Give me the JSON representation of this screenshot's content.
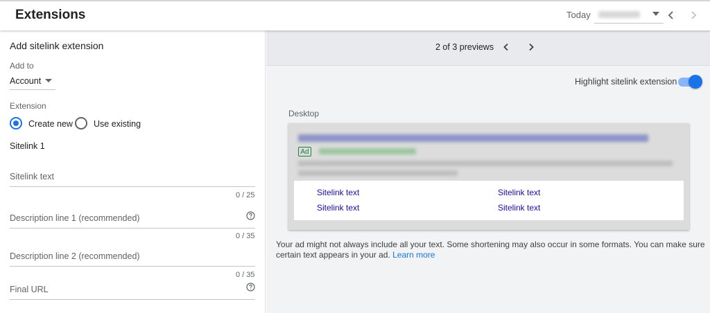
{
  "header": {
    "title": "Extensions",
    "today_label": "Today",
    "date_value": ""
  },
  "form": {
    "section_title": "Add sitelink extension",
    "add_to_label": "Add to",
    "add_to_value": "Account",
    "extension_label": "Extension",
    "radio_create": "Create new",
    "radio_existing": "Use existing",
    "selected": "Create new",
    "sitelink_heading": "Sitelink 1",
    "fields": [
      {
        "label": "Sitelink text",
        "counter": "0 / 25",
        "help": false
      },
      {
        "label": "Description line 1 (recommended)",
        "counter": "0 / 35",
        "help": true
      },
      {
        "label": "Description line 2 (recommended)",
        "counter": "0 / 35",
        "help": false
      },
      {
        "label": "Final URL",
        "counter": "",
        "help": true
      }
    ]
  },
  "preview": {
    "count_text": "2 of 3 previews",
    "highlight_label": "Highlight sitelink extension",
    "highlight_on": true,
    "device_label": "Desktop",
    "ad_badge": "Ad",
    "sitelinks": [
      "Sitelink text",
      "Sitelink text",
      "Sitelink text",
      "Sitelink text"
    ],
    "note_text": "Your ad might not always include all your text. Some shortening may also occur in some formats. You can make sure certain text appears in your ad.",
    "learn_more": "Learn more"
  },
  "icons": {
    "prev": "chevron-left-icon",
    "next": "chevron-right-icon",
    "help": "help-circle-icon",
    "dropdown": "caret-down-icon"
  },
  "colors": {
    "accent": "#1a73e8",
    "link": "#1a0dab",
    "ad_green": "#188038"
  }
}
